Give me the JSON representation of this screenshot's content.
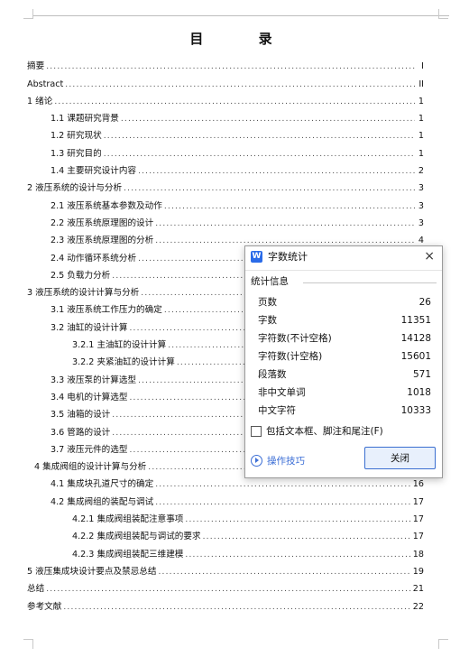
{
  "toc": {
    "title": "目 录",
    "entries": [
      {
        "text": "摘要",
        "page": "I",
        "level": "l1"
      },
      {
        "text": "Abstract",
        "page": "II",
        "level": "l1"
      },
      {
        "text": "1 绪论",
        "page": "1",
        "level": "l1"
      },
      {
        "text": "1.1 课题研究背景",
        "page": "1",
        "level": "l2"
      },
      {
        "text": "1.2 研究现状",
        "page": "1",
        "level": "l2"
      },
      {
        "text": "1.3 研究目的",
        "page": "1",
        "level": "l2"
      },
      {
        "text": "1.4 主要研究设计内容",
        "page": "2",
        "level": "l2"
      },
      {
        "text": "2 液压系统的设计与分析",
        "page": "3",
        "level": "l1"
      },
      {
        "text": "2.1 液压系统基本参数及动作",
        "page": "3",
        "level": "l2"
      },
      {
        "text": "2.2 液压系统原理图的设计",
        "page": "3",
        "level": "l2"
      },
      {
        "text": "2.3 液压系统原理图的分析",
        "page": "4",
        "level": "l2"
      },
      {
        "text": "2.4 动作循环系统分析",
        "page": "",
        "level": "l2"
      },
      {
        "text": "2.5 负载力分析",
        "page": "",
        "level": "l2"
      },
      {
        "text": "3 液压系统的设计计算与分析",
        "page": "",
        "level": "l1"
      },
      {
        "text": "3.1 液压系统工作压力的确定",
        "page": "",
        "level": "l2"
      },
      {
        "text": "3.2 油缸的设计计算",
        "page": "",
        "level": "l2"
      },
      {
        "text": "3.2.1 主油缸的设计计算",
        "page": "",
        "level": "l3"
      },
      {
        "text": "3.2.2 夹紧油缸的设计计算",
        "page": "",
        "level": "l3"
      },
      {
        "text": "3.3 液压泵的计算选型",
        "page": "",
        "level": "l2"
      },
      {
        "text": "3.4 电机的计算选型",
        "page": "",
        "level": "l2"
      },
      {
        "text": "3.5 油箱的设计",
        "page": "",
        "level": "l2"
      },
      {
        "text": "3.6 管路的设计",
        "page": "",
        "level": "l2"
      },
      {
        "text": "3.7 液压元件的选型",
        "page": "",
        "level": "l2"
      },
      {
        "text": "4 集成阀组的设计计算与分析",
        "page": "",
        "level": "l1b"
      },
      {
        "text": "4.1 集成块孔道尺寸的确定",
        "page": "16",
        "level": "l2"
      },
      {
        "text": "4.2 集成阀组的装配与调试",
        "page": "17",
        "level": "l2"
      },
      {
        "text": "4.2.1 集成阀组装配注意事项",
        "page": "17",
        "level": "l3"
      },
      {
        "text": "4.2.2 集成阀组装配与调试的要求",
        "page": "17",
        "level": "l3"
      },
      {
        "text": "4.2.3 集成阀组装配三维建模",
        "page": "18",
        "level": "l3"
      },
      {
        "text": "5 液压集成块设计要点及禁忌总结",
        "page": "19",
        "level": "l1"
      },
      {
        "text": "总结",
        "page": "21",
        "level": "l1"
      },
      {
        "text": "参考文献",
        "page": "22",
        "level": "l1"
      }
    ]
  },
  "dialog": {
    "app_icon_glyph": "W",
    "title": "字数统计",
    "close_glyph": "×",
    "section_label": "统计信息",
    "stats": [
      {
        "label": "页数",
        "value": "26"
      },
      {
        "label": "字数",
        "value": "11351"
      },
      {
        "label": "字符数(不计空格)",
        "value": "14128"
      },
      {
        "label": "字符数(计空格)",
        "value": "15601"
      },
      {
        "label": "段落数",
        "value": "571"
      },
      {
        "label": "非中文单词",
        "value": "1018"
      },
      {
        "label": "中文字符",
        "value": "10333"
      }
    ],
    "checkbox_label": "包括文本框、脚注和尾注(F)",
    "tips_label": "操作技巧",
    "close_button_label": "关闭",
    "colors": {
      "accent": "#3b6fd0",
      "icon": "#2a6be8"
    }
  }
}
